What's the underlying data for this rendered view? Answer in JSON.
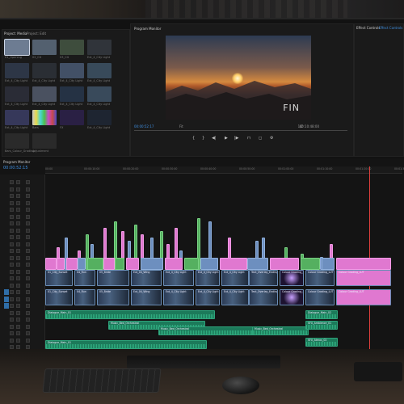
{
  "panels": {
    "project_tab": "Project: Media",
    "project_tab2": "Project: Edit",
    "program_title": "Program Monitor",
    "effects_tab": "Effect Controls",
    "effects_tab2": "Effect Controls",
    "timeline_title": "Program Monitor"
  },
  "project": {
    "items": [
      {
        "label": "01_Opening",
        "color": "#6d7c92"
      },
      {
        "label": "02_Cit",
        "color": "#53606f"
      },
      {
        "label": "03_Cit",
        "color": "#3e4d3d"
      },
      {
        "label": "Ext_4_City Light",
        "color": "#30343a"
      },
      {
        "label": "Ext_4_City Light",
        "color": "#2d3646"
      },
      {
        "label": "Ext_4_City Light",
        "color": "#2a2e34"
      },
      {
        "label": "Ext_4_City Light",
        "color": "#425066"
      },
      {
        "label": "Ext_4_City Light",
        "color": "#384a5a"
      },
      {
        "label": "Ext_4_City Light",
        "color": "#2a2c36"
      },
      {
        "label": "Ext_4_City Light",
        "color": "#4a5160"
      },
      {
        "label": "Ext_4_City Light",
        "color": "#253244"
      },
      {
        "label": "Ext_4_City Light",
        "color": "#394a5b"
      },
      {
        "label": "Ext_4_City Light",
        "color": "#36385a"
      },
      {
        "label": "Bars",
        "color": "#8b6bd0"
      },
      {
        "label": "FX",
        "color": "#2a2044"
      },
      {
        "label": "Ext_4_City Light",
        "color": "#1e2531"
      },
      {
        "label": "Bars_Colour_Grading",
        "color": "#2a2a2a"
      },
      {
        "label": "Adjustment",
        "color": "#2a2a2a"
      }
    ]
  },
  "monitor": {
    "timecode": "00:00:52:17",
    "fit": "Fit",
    "duration": "00:10:48:00",
    "overlay_text": "FIN",
    "zoom": "1/2"
  },
  "timeline": {
    "timecode": "00:00:52:15",
    "ruler": [
      "00:00",
      "00:00:10:00",
      "00:00:20:00",
      "00:00:30:00",
      "00:00:40:00",
      "00:00:50:00",
      "00:01:00:00",
      "00:01:10:00",
      "00:01:20:00",
      "00:01:30:00"
    ],
    "tracks_video": [
      "V6",
      "V5",
      "V4",
      "V3",
      "V2",
      "V1"
    ],
    "tracks_audio": [
      "A1",
      "A2",
      "A3",
      "A4",
      "A5",
      "A6",
      "A7",
      "A8",
      "A9",
      "A10"
    ],
    "video_clips": [
      {
        "label": "01_City_Sunset",
        "kind": "vid"
      },
      {
        "label": "04_Run",
        "kind": "vid"
      },
      {
        "label": "05_Bride",
        "kind": "vid"
      },
      {
        "label": "Ext_04_Wing",
        "kind": "vid"
      },
      {
        "label": "Ext_4_City Light",
        "kind": "vid"
      },
      {
        "label": "Ext_4_City Light",
        "kind": "vid"
      },
      {
        "label": "Ext_4_City Light",
        "kind": "vid"
      },
      {
        "label": "Text_Overlay_Ending",
        "kind": "vid"
      },
      {
        "label": "Colour Grading_LUT",
        "kind": "vid"
      }
    ],
    "audio_clips": [
      "Dialogue_Main_01",
      "Music_Bed_Orchestral",
      "Music_Bed_Orchestral",
      "Music_Bed_Orchestral",
      "Dialogue_Main_01",
      "Dialogue_Main_02",
      "SFX_Ambience_01",
      "SFX_Atmos_02",
      "SFX_Footsteps_Wet",
      "Ambience_Wind"
    ]
  },
  "colors": {
    "accent": "#3f8fe0",
    "playhead": "#e0403c",
    "pink": "#e078d0",
    "audio": "#1c7a5a"
  }
}
